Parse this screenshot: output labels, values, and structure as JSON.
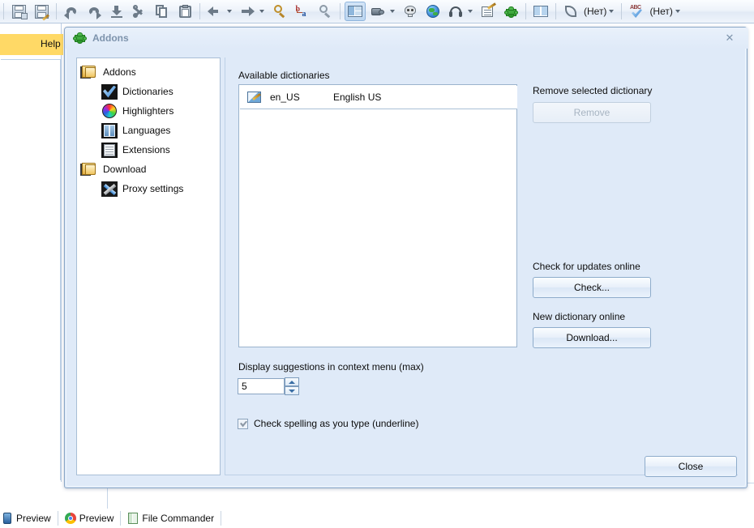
{
  "toolbar": {
    "items": [
      {
        "name": "save-as-icon",
        "type": "icon"
      },
      {
        "name": "save-edit-icon",
        "type": "icon"
      },
      {
        "name": "undo-icon",
        "type": "icon"
      },
      {
        "name": "redo-icon",
        "type": "icon"
      },
      {
        "name": "download-icon",
        "type": "icon"
      },
      {
        "name": "cut-icon",
        "type": "icon"
      },
      {
        "name": "copy-icon",
        "type": "icon"
      },
      {
        "name": "paste-icon",
        "type": "icon"
      },
      {
        "name": "back-icon",
        "type": "icon"
      },
      {
        "name": "forward-icon",
        "type": "icon"
      },
      {
        "name": "find-icon",
        "type": "icon"
      },
      {
        "name": "replace-icon",
        "type": "icon"
      },
      {
        "name": "zoom-icon",
        "type": "icon"
      },
      {
        "name": "layout-panes-icon",
        "type": "icon"
      },
      {
        "name": "webcam-icon",
        "type": "icon"
      },
      {
        "name": "debug-icon",
        "type": "icon"
      },
      {
        "name": "browser-icon",
        "type": "icon"
      },
      {
        "name": "headset-icon",
        "type": "icon"
      },
      {
        "name": "notes-icon",
        "type": "icon"
      },
      {
        "name": "addons-icon",
        "type": "icon"
      },
      {
        "name": "split-view-icon",
        "type": "icon"
      }
    ],
    "style_dropdown_label": "(Нет)",
    "spell_dropdown_label": "(Нет)"
  },
  "background": {
    "help_label": "Help"
  },
  "dialog": {
    "title": "Addons",
    "title_icon": "puzzle-icon",
    "close_label": "✕",
    "close_button_label": "Close"
  },
  "tree": {
    "items": [
      {
        "label": "Addons",
        "icon": "folder-icon",
        "level": 0
      },
      {
        "label": "Dictionaries",
        "icon": "check-icon",
        "level": 1
      },
      {
        "label": "Highlighters",
        "icon": "colorwheel-icon",
        "level": 1
      },
      {
        "label": "Languages",
        "icon": "book-icon",
        "level": 1
      },
      {
        "label": "Extensions",
        "icon": "document-icon",
        "level": 1
      },
      {
        "label": "Download",
        "icon": "folder-icon",
        "level": 0
      },
      {
        "label": "Proxy settings",
        "icon": "tools-icon",
        "level": 1
      }
    ]
  },
  "panel": {
    "available_label": "Available dictionaries",
    "dictionaries": [
      {
        "code": "en_US",
        "name": "English US",
        "icon": "dictionary-icon"
      }
    ],
    "remove_label": "Remove selected dictionary",
    "remove_button": "Remove",
    "remove_button_disabled": true,
    "check_label": "Check for updates online",
    "check_button": "Check...",
    "download_label": "New dictionary online",
    "download_button": "Download...",
    "suggestions_label": "Display suggestions in context menu (max)",
    "suggestions_value": "5",
    "spellcheck_label": "Check spelling as you type (underline)",
    "spellcheck_checked": true
  },
  "statusbar": {
    "tabs": [
      {
        "label": "Preview",
        "icon": "preview-icon"
      },
      {
        "label": "Preview",
        "icon": "chrome-icon"
      },
      {
        "label": "File Commander",
        "icon": "file-commander-icon"
      }
    ]
  },
  "colors": {
    "dialog_bg": "#dfeaf8",
    "dialog_border": "#8ba7c7",
    "title_text": "#7d93ac",
    "help_bar": "#ffd966",
    "accent": "#2f7fd0"
  }
}
